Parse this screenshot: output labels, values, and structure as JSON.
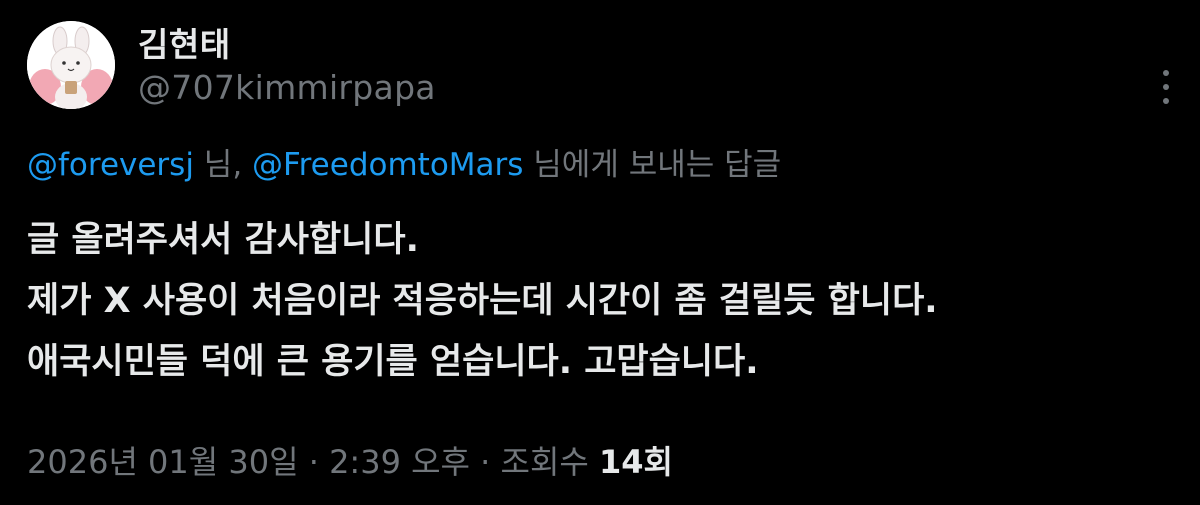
{
  "author": {
    "display_name": "김현태",
    "handle": "@707kimmirpapa",
    "avatar_icon": "bunny-avatar-icon"
  },
  "reply": {
    "mention_1": "@foreversj",
    "sep_1": " 님, ",
    "mention_2": "@FreedomtoMars",
    "suffix": " 님에게 보내는 답글"
  },
  "body": {
    "lines": [
      "글 올려주셔서 감사합니다.",
      "제가 X 사용이 처음이라 적응하는데 시간이 좀 걸릴듯 합니다.",
      "애국시민들 덕에 큰 용기를 얻습니다. 고맙습니다."
    ]
  },
  "meta": {
    "date": "2026년 01월 30일",
    "dot_1": " · ",
    "time": "2:39 오후",
    "dot_2": " · ",
    "views_label": "조회수 ",
    "views_count": "14회"
  },
  "colors": {
    "background": "#000000",
    "text": "#e7e9ea",
    "secondary": "#71767b",
    "accent": "#1d9bf0"
  }
}
